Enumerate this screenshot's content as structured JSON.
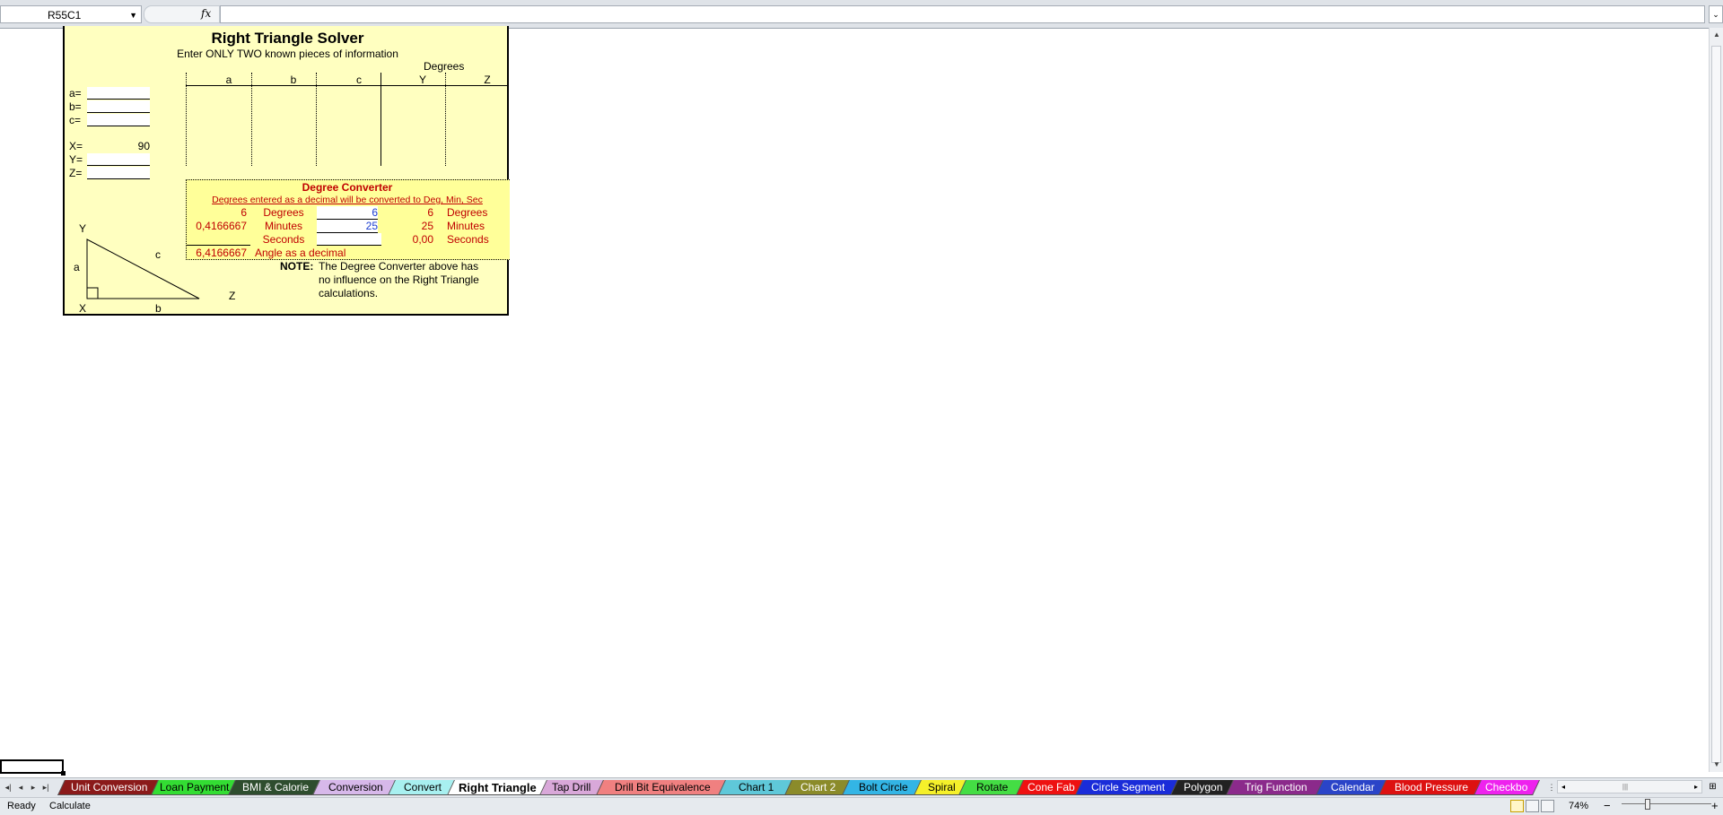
{
  "formula_bar": {
    "name_box": "R55C1",
    "fx_label": "fx",
    "formula": ""
  },
  "sheet": {
    "title": "Right Triangle Solver",
    "subtitle": "Enter ONLY TWO known pieces of information",
    "degrees_header": "Degrees",
    "col_headers": [
      "a",
      "b",
      "c",
      "Y",
      "Z"
    ],
    "inputs": {
      "a_label": "a=",
      "b_label": "b=",
      "c_label": "c=",
      "x_label": "X=",
      "x_value": "90",
      "y_label": "Y=",
      "z_label": "Z="
    },
    "converter": {
      "title": "Degree Converter",
      "subtitle": "Degrees entered as a decimal will be converted to Deg, Min, Sec",
      "row1_left": "6",
      "row1_label": "Degrees",
      "row1_input": "6",
      "row1_out": "6",
      "row1_out_label": "Degrees",
      "row2_left": "0,4166667",
      "row2_label": "Minutes",
      "row2_input": "25",
      "row2_out": "25",
      "row2_out_label": "Minutes",
      "row3_label": "Seconds",
      "row3_out": "0,00",
      "row3_out_label": "Seconds",
      "decimal_value": "6,4166667",
      "decimal_label": "Angle as a decimal"
    },
    "note_label": "NOTE:",
    "note_lines": [
      "The Degree Converter above has",
      "no influence on the Right Triangle",
      "calculations."
    ],
    "triangle": {
      "Y": "Y",
      "a": "a",
      "c": "c",
      "X": "X",
      "b": "b",
      "Z": "Z"
    }
  },
  "tabs": [
    {
      "label": "Unit Conversion",
      "bg": "#8b1a1a",
      "fg": "#ffffff"
    },
    {
      "label": "Loan Payment",
      "bg": "#33dd33",
      "fg": "#000000"
    },
    {
      "label": "BMI & Calorie",
      "bg": "#2e4d2e",
      "fg": "#ffffff"
    },
    {
      "label": "Conversion",
      "bg": "#d7b8ea",
      "fg": "#000000"
    },
    {
      "label": "Convert",
      "bg": "#a8f0f0",
      "fg": "#000000"
    },
    {
      "label": "Right Triangle",
      "bg": "#ffffff",
      "fg": "#000000"
    },
    {
      "label": "Tap Drill",
      "bg": "#d9a8d9",
      "fg": "#000000"
    },
    {
      "label": "Drill Bit Equivalence",
      "bg": "#f08080",
      "fg": "#000000"
    },
    {
      "label": "Chart 1",
      "bg": "#5fc8d9",
      "fg": "#000000"
    },
    {
      "label": "Chart 2",
      "bg": "#8b8b2a",
      "fg": "#ffffff"
    },
    {
      "label": "Bolt Circle",
      "bg": "#33b5e5",
      "fg": "#000000"
    },
    {
      "label": "Spiral",
      "bg": "#f5f02a",
      "fg": "#000000"
    },
    {
      "label": "Rotate",
      "bg": "#44dd44",
      "fg": "#000000"
    },
    {
      "label": "Cone Fab",
      "bg": "#ee1111",
      "fg": "#ffffff"
    },
    {
      "label": "Circle Segment",
      "bg": "#1a2cd9",
      "fg": "#ffffff"
    },
    {
      "label": "Polygon",
      "bg": "#222222",
      "fg": "#ffffff"
    },
    {
      "label": "Trig Function",
      "bg": "#8b2a8b",
      "fg": "#ffffff"
    },
    {
      "label": "Calendar",
      "bg": "#2a44c8",
      "fg": "#ffffff"
    },
    {
      "label": "Blood Pressure",
      "bg": "#dd1111",
      "fg": "#ffffff"
    },
    {
      "label": "Checkbo",
      "bg": "#ee22ee",
      "fg": "#ffffff"
    }
  ],
  "status": {
    "ready": "Ready",
    "calculate": "Calculate",
    "zoom": "74%",
    "zoom_out": "−",
    "zoom_in": "+"
  }
}
